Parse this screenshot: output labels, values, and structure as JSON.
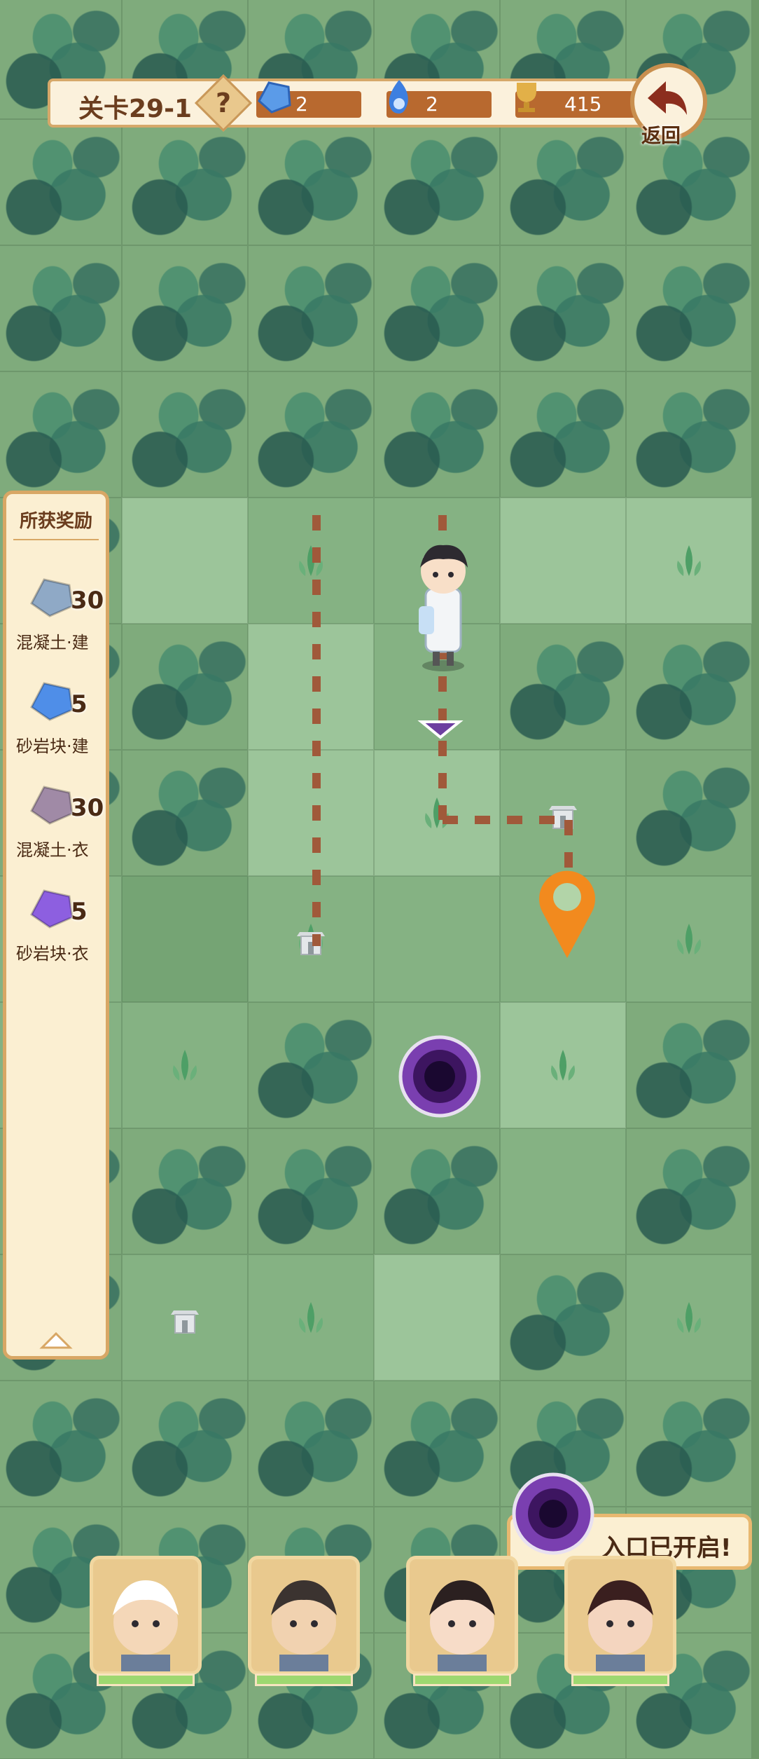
{
  "hud": {
    "level_label": "关卡29-1",
    "help_label": "?",
    "sandstone_build_count": "2",
    "blue_flame_count": "2",
    "trophy_count": "415",
    "back_label": "返回"
  },
  "rewards": {
    "title": "所获奖励",
    "items": [
      {
        "name": "混凝土·建",
        "count": "30",
        "icon": "concrete-build-icon",
        "color": "#8fa9c6"
      },
      {
        "name": "砂岩块·建",
        "count": "5",
        "icon": "sandstone-build-icon",
        "color": "#4f8ee8"
      },
      {
        "name": "混凝土·衣",
        "count": "30",
        "icon": "concrete-cloth-icon",
        "color": "#a08aa6"
      },
      {
        "name": "砂岩块·衣",
        "count": "5",
        "icon": "sandstone-cloth-icon",
        "color": "#8d5fe0"
      }
    ]
  },
  "toast": {
    "message": "入口已开启!"
  },
  "heroes": [
    {
      "name": "hero-portrait-scholar"
    },
    {
      "name": "hero-portrait-monk"
    },
    {
      "name": "hero-portrait-lady"
    },
    {
      "name": "hero-portrait-warrior-girl"
    }
  ],
  "colors": {
    "accent": "#d6a86a",
    "resource_bar": "#b8692f",
    "marker": "#f28a1e",
    "portal": "#5a2a8a"
  }
}
